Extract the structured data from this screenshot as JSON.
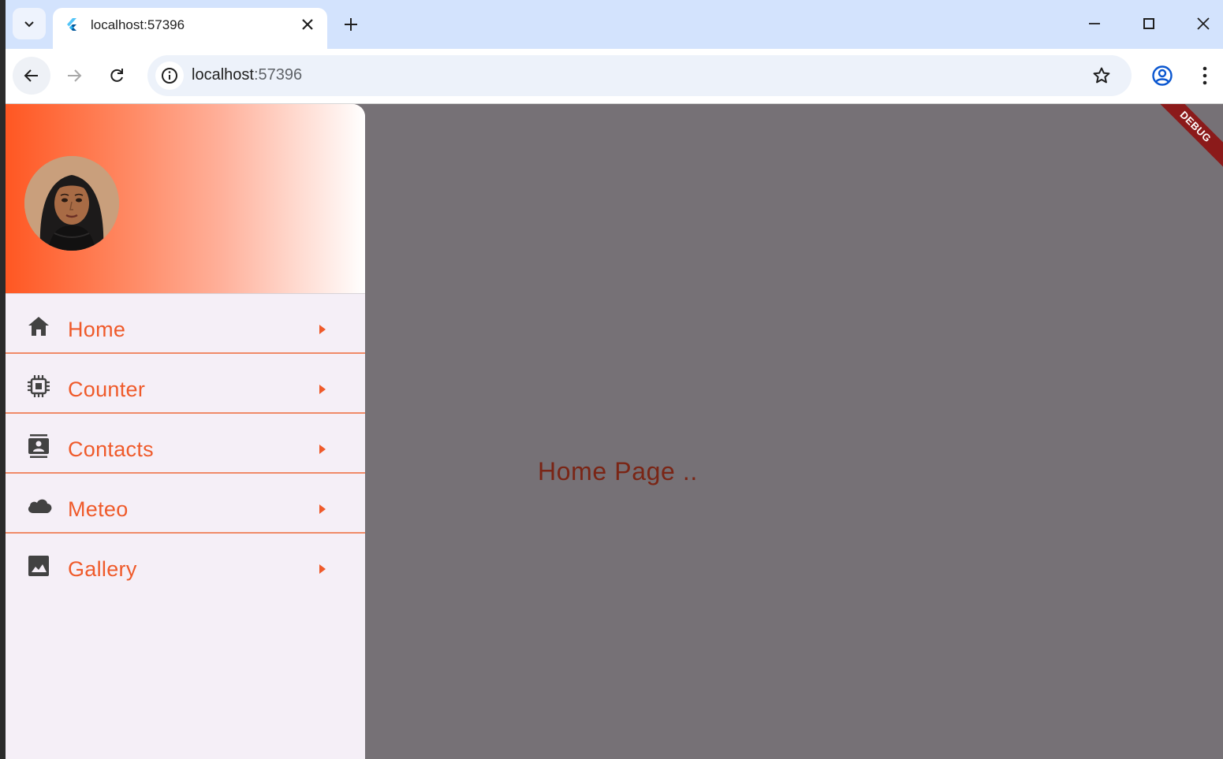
{
  "browser": {
    "tab_title": "localhost:57396",
    "url_host": "localhost",
    "url_port": ":57396"
  },
  "app": {
    "debug_banner": "DEBUG",
    "home_text": "Home Page ..",
    "menu_items": [
      {
        "label": "Home",
        "icon": "home-icon"
      },
      {
        "label": "Counter",
        "icon": "chip-icon"
      },
      {
        "label": "Contacts",
        "icon": "contacts-icon"
      },
      {
        "label": "Meteo",
        "icon": "cloud-icon"
      },
      {
        "label": "Gallery",
        "icon": "image-icon"
      }
    ]
  },
  "colors": {
    "accent": "#ef5a2a",
    "scrim": "#767176",
    "drawer_bg": "#f5eff7",
    "home_text": "#7a2515"
  }
}
